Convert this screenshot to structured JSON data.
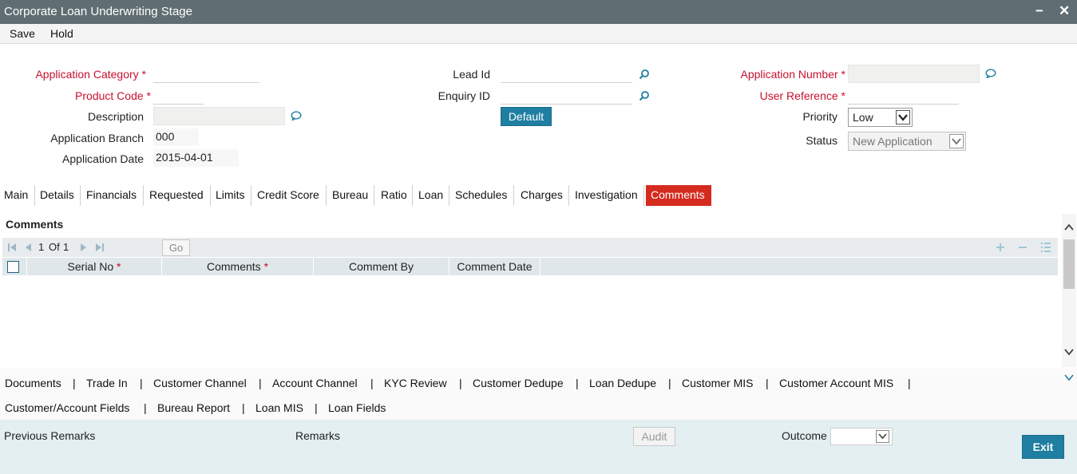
{
  "window": {
    "title": "Corporate Loan Underwriting Stage",
    "minimize": "−",
    "close": "✕"
  },
  "menu": {
    "save": "Save",
    "hold": "Hold"
  },
  "form": {
    "application_category_label": "Application Category",
    "product_code_label": "Product Code",
    "description_label": "Description",
    "application_branch_label": "Application Branch",
    "application_branch_value": "000",
    "application_date_label": "Application Date",
    "application_date_value": "2015-04-01",
    "lead_id_label": "Lead Id",
    "enquiry_id_label": "Enquiry ID",
    "default_button": "Default",
    "application_number_label": "Application Number",
    "user_reference_label": "User Reference",
    "priority_label": "Priority",
    "priority_value": "Low",
    "status_label": "Status",
    "status_value": "New Application",
    "required_mark": "*"
  },
  "tabs": [
    "Main",
    "Details",
    "Financials",
    "Requested",
    "Limits",
    "Credit Score",
    "Bureau",
    "Ratio",
    "Loan",
    "Schedules",
    "Charges",
    "Investigation",
    "Comments"
  ],
  "active_tab": "Comments",
  "comments": {
    "section_title": "Comments",
    "pager": {
      "page": "1",
      "of": "Of",
      "total": "1",
      "go": "Go"
    },
    "columns": [
      "Serial No",
      "Comments",
      "Comment By",
      "Comment Date"
    ]
  },
  "links": {
    "row1": [
      "Documents",
      "Trade In",
      "Customer Channel",
      "Account Channel",
      "KYC Review",
      "Customer Dedupe",
      "Loan Dedupe",
      "Customer MIS",
      "Customer Account MIS"
    ],
    "row2": [
      "Customer/Account Fields",
      "Bureau Report",
      "Loan MIS",
      "Loan Fields"
    ],
    "separator": "|"
  },
  "footer": {
    "previous_remarks": "Previous Remarks",
    "remarks": "Remarks",
    "audit": "Audit",
    "outcome": "Outcome",
    "exit": "Exit"
  },
  "colors": {
    "titlebar": "#5f6e72",
    "accent": "#1f7ea1",
    "active_tab": "#d52b1e",
    "required": "#c8102e"
  }
}
